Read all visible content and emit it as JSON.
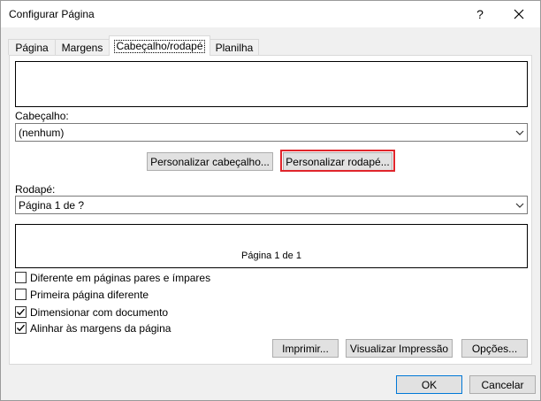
{
  "window": {
    "title": "Configurar Página",
    "help_glyph": "?"
  },
  "tabs": [
    {
      "label": "Página",
      "active": false
    },
    {
      "label": "Margens",
      "active": false
    },
    {
      "label": "Cabeçalho/rodapé",
      "active": true
    },
    {
      "label": "Planilha",
      "active": false
    }
  ],
  "header": {
    "label": "Cabeçalho:",
    "selected": "(nenhum)",
    "preview_text": ""
  },
  "customize": {
    "header_button": "Personalizar cabeçalho...",
    "footer_button": "Personalizar rodapé...",
    "highlight_color": "#e0252b"
  },
  "footer": {
    "label": "Rodapé:",
    "selected": "Página 1 de ?",
    "preview_text": "Página 1 de 1"
  },
  "options": [
    {
      "label": "Diferente em páginas pares e ímpares",
      "checked": false
    },
    {
      "label": "Primeira página diferente",
      "checked": false
    },
    {
      "label": "Dimensionar com documento",
      "checked": true
    },
    {
      "label": "Alinhar às margens da página",
      "checked": true
    }
  ],
  "actions": {
    "print": "Imprimir...",
    "preview": "Visualizar Impressão",
    "options": "Opções..."
  },
  "dialog_buttons": {
    "ok": "OK",
    "cancel": "Cancelar"
  },
  "icons": {
    "close": "close-icon",
    "dropdown": "chevron-down-icon",
    "check": "checkmark-icon"
  }
}
